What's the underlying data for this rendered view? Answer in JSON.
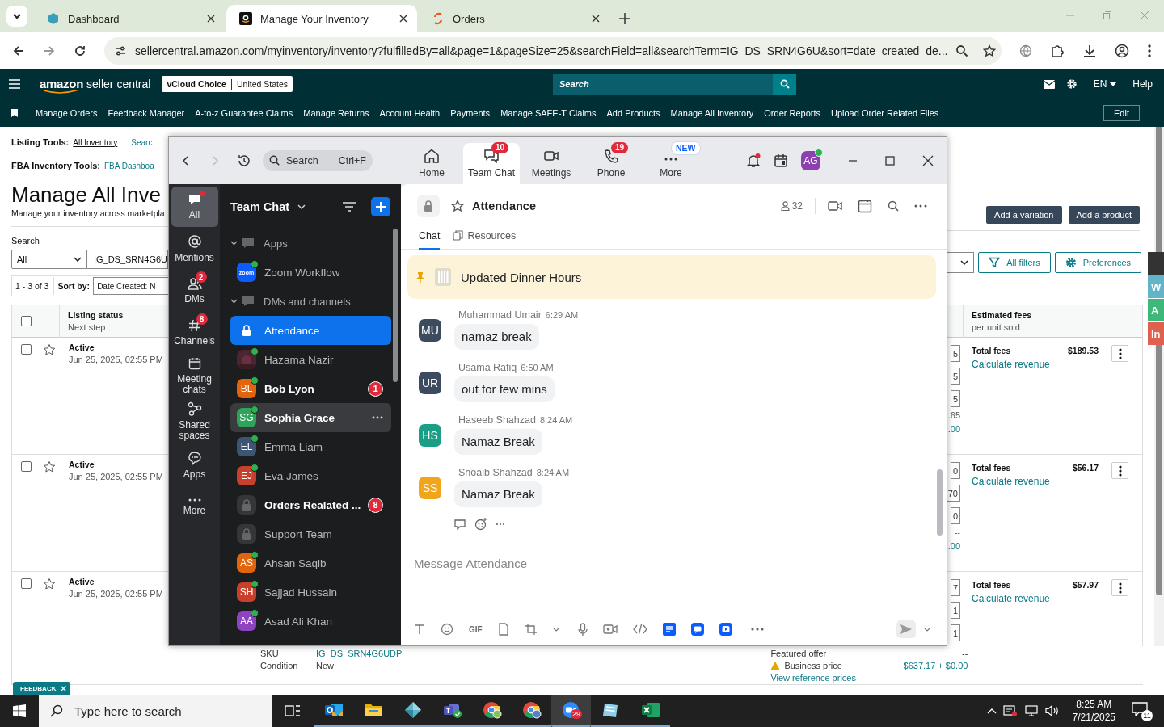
{
  "browser": {
    "tabs": [
      {
        "title": "Dashboard",
        "kind": "dashboard",
        "selected": false
      },
      {
        "title": "Manage Your Inventory",
        "kind": "amazon",
        "selected": true
      },
      {
        "title": "Orders",
        "kind": "orders",
        "selected": false
      }
    ],
    "url": "sellercentral.amazon.com/myinventory/inventory?fulfilledBy=all&page=1&pageSize=25&searchField=all&searchTerm=IG_DS_SRN4G6U&sort=date_created_de..."
  },
  "seller_header": {
    "brand": "amazon",
    "product": "seller central",
    "store": "vCloud Choice",
    "marketplace": "United States",
    "search_placeholder": "Search",
    "language": "EN",
    "help": "Help"
  },
  "nav": {
    "links": [
      "Manage Orders",
      "Feedback Manager",
      "A-to-z Guarantee Claims",
      "Manage Returns",
      "Account Health",
      "Payments",
      "Manage SAFE-T Claims",
      "Add Products",
      "Manage All Inventory",
      "Order Reports",
      "Upload Order Related Files"
    ],
    "edit": "Edit"
  },
  "listing_tools": {
    "label": "Listing Tools:",
    "links": [
      "All Inventory",
      "Searc"
    ]
  },
  "fba_tools": {
    "label": "FBA Inventory Tools:",
    "link": "FBA Dashboa"
  },
  "page_title": "Manage All Inve",
  "page_subtitle": "Manage your inventory across marketpla",
  "search": {
    "label": "Search",
    "scope": "All",
    "value": "IG_DS_SRN4G6U"
  },
  "results": {
    "count": "1 - 3 of 3",
    "sort_label": "Sort by:",
    "sort_value": "Date Created: N"
  },
  "actions": [
    "Add a variation",
    "Add a product"
  ],
  "filters": [
    {
      "label": "All filters",
      "kind": "filter"
    },
    {
      "label": "Preferences",
      "kind": "gear"
    }
  ],
  "table": {
    "select_all": false,
    "columns": [
      {
        "title": "Listing status",
        "subtitle": "Next step"
      },
      {
        "title": "Estimated fees",
        "subtitle": "per unit sold"
      }
    ],
    "rows": [
      {
        "checked": false,
        "starred": false,
        "status": "Active",
        "date": "Jun 25, 2025, 02:55 PM",
        "boxes": [
          "5",
          "5",
          "5"
        ],
        "extras": [
          ".65",
          ".00"
        ],
        "fees_label": "Total fees",
        "fees": "$189.53",
        "link": "Calculate revenue"
      },
      {
        "checked": false,
        "starred": false,
        "status": "Active",
        "date": "Jun 25, 2025, 02:55 PM",
        "boxes": [
          "0",
          "70",
          "0"
        ],
        "extras": [
          "--",
          ".00"
        ],
        "fees_label": "Total fees",
        "fees": "$56.17",
        "link": "Calculate revenue"
      },
      {
        "checked": false,
        "starred": false,
        "status": "Active",
        "date": "Jun 25, 2025, 02:55 PM",
        "boxes": [
          "7",
          "1",
          "1"
        ],
        "extras": [],
        "fees_label": "Total fees",
        "fees": "$57.97",
        "link": "Calculate revenue"
      }
    ]
  },
  "listing_detail": {
    "sku_label": "SKU",
    "sku": "IG_DS_SRN4G6UDP",
    "condition_label": "Condition",
    "condition": "New",
    "featured_label": "Featured offer",
    "featured_value": "--",
    "business_label": "Business price",
    "business_value": "$637.17 + $0.00",
    "reference_link": "View reference prices"
  },
  "side_tabs": [
    {
      "label": "W",
      "color": "#62b4c8"
    },
    {
      "label": "A",
      "color": "#3cb878"
    },
    {
      "label": "In",
      "color": "#e0604f"
    }
  ],
  "feedback": "FEEDBACK",
  "zoom": {
    "search": {
      "placeholder": "Search",
      "shortcut": "Ctrl+F"
    },
    "tabs": [
      {
        "label": "Home",
        "kind": "home",
        "selected": false
      },
      {
        "label": "Team Chat",
        "kind": "chat",
        "selected": true,
        "badge": "10"
      },
      {
        "label": "Meetings",
        "kind": "video",
        "selected": false
      },
      {
        "label": "Phone",
        "kind": "phone",
        "selected": false,
        "badge": "19"
      },
      {
        "label": "More",
        "kind": "more",
        "selected": false,
        "tag": "NEW"
      }
    ],
    "profile": {
      "initials": "AG"
    },
    "rail": [
      {
        "label": "All",
        "kind": "all",
        "selected": true,
        "unread": true
      },
      {
        "label": "Mentions",
        "kind": "mentions",
        "selected": false,
        "unread": false
      },
      {
        "label": "DMs",
        "kind": "dms",
        "selected": false,
        "unread": false,
        "badge": "2"
      },
      {
        "label": "Channels",
        "kind": "channels",
        "selected": false,
        "unread": false,
        "badge": "8"
      },
      {
        "label": "Meeting chats",
        "kind": "meetings",
        "selected": false,
        "unread": false
      },
      {
        "label": "Shared spaces",
        "kind": "shared",
        "selected": false,
        "unread": false
      },
      {
        "label": "Apps",
        "kind": "apps",
        "selected": false,
        "unread": false
      },
      {
        "label": "More",
        "kind": "more",
        "selected": false,
        "unread": false
      }
    ],
    "list": {
      "title": "Team Chat",
      "sections": [
        {
          "title": "Apps",
          "expanded": true,
          "items": [
            {
              "name": "Zoom Workflow",
              "kind": "app",
              "logo": "zoom",
              "online": true,
              "selected": false,
              "unread": false,
              "highlighted": false
            }
          ]
        },
        {
          "title": "DMs and channels",
          "expanded": true,
          "items": [
            {
              "name": "Attendance",
              "kind": "channel",
              "online": false,
              "selected": true,
              "unread": false,
              "highlighted": false
            },
            {
              "name": "Hazama Nazir",
              "online": true,
              "selected": false,
              "unread": false,
              "highlighted": false
            },
            {
              "name": "Bob Lyon",
              "kind": "person",
              "initials": "BL",
              "color": "#e0650e",
              "online": true,
              "selected": false,
              "unread": true,
              "highlighted": false,
              "badge": "1"
            },
            {
              "name": "Sophia Grace",
              "kind": "person",
              "initials": "SG",
              "color": "#2fa35a",
              "online": true,
              "selected": false,
              "unread": true,
              "highlighted": true
            },
            {
              "name": "Emma Liam",
              "kind": "person",
              "initials": "EL",
              "color": "#3d5573",
              "online": true,
              "selected": false,
              "unread": false,
              "highlighted": false
            },
            {
              "name": "Eva James",
              "kind": "person",
              "initials": "EJ",
              "color": "#c8402c",
              "online": true,
              "selected": false,
              "unread": false,
              "highlighted": false
            },
            {
              "name": "Orders Realated ...",
              "kind": "channel",
              "online": false,
              "selected": false,
              "unread": true,
              "highlighted": false,
              "badge": "8"
            },
            {
              "name": "Support Team",
              "kind": "channel",
              "online": false,
              "selected": false,
              "unread": false,
              "highlighted": false
            },
            {
              "name": "Ahsan Saqib",
              "kind": "person",
              "initials": "AS",
              "color": "#e0650e",
              "online": true,
              "selected": false,
              "unread": false,
              "highlighted": false
            },
            {
              "name": "Sajjad Hussain",
              "kind": "person",
              "initials": "SH",
              "color": "#c8402c",
              "online": true,
              "selected": false,
              "unread": false,
              "highlighted": false
            },
            {
              "name": "Asad Ali Khan",
              "kind": "person",
              "initials": "AA",
              "color": "#8e44c0",
              "online": true,
              "selected": false,
              "unread": false,
              "highlighted": false
            }
          ]
        }
      ]
    },
    "chat": {
      "title": "Attendance",
      "members": "32",
      "tabs": [
        {
          "label": "Chat",
          "selected": true
        },
        {
          "label": "Resources",
          "selected": false
        }
      ],
      "pinned": "Updated Dinner Hours",
      "messages": [
        {
          "sender": "Muhammad Umair",
          "time": "6:29 AM",
          "text": "namaz break",
          "initials": "MU",
          "color": "#3d4b5f"
        },
        {
          "sender": "Usama Rafiq",
          "time": "6:50 AM",
          "text": "out for few mins",
          "initials": "UR",
          "color": "#3d4b5f"
        },
        {
          "sender": "Haseeb Shahzad",
          "time": "8:24 AM",
          "text": "Namaz Break",
          "initials": "HS",
          "color": "#1a9e86"
        },
        {
          "sender": "Shoaib Shahzad",
          "time": "8:24 AM",
          "text": "Namaz Break",
          "initials": "SS",
          "color": "#f1a51c"
        }
      ],
      "compose": {
        "placeholder": "Message Attendance",
        "gif": "GIF"
      }
    }
  },
  "taskbar": {
    "search_placeholder": "Type here to search",
    "apps": [
      {
        "kind": "outlook",
        "active": false
      },
      {
        "kind": "explorer",
        "active": false
      },
      {
        "kind": "cube",
        "active": false
      },
      {
        "kind": "teams",
        "active": false
      },
      {
        "kind": "chrome",
        "active": false
      },
      {
        "kind": "chrome-profile",
        "active": false
      },
      {
        "kind": "zoom",
        "active": true,
        "badge": "29"
      },
      {
        "kind": "notes",
        "active": false
      },
      {
        "kind": "excel",
        "active": false
      }
    ],
    "time": "8:25 AM",
    "date": "7/21/2025",
    "notifications": "11"
  }
}
